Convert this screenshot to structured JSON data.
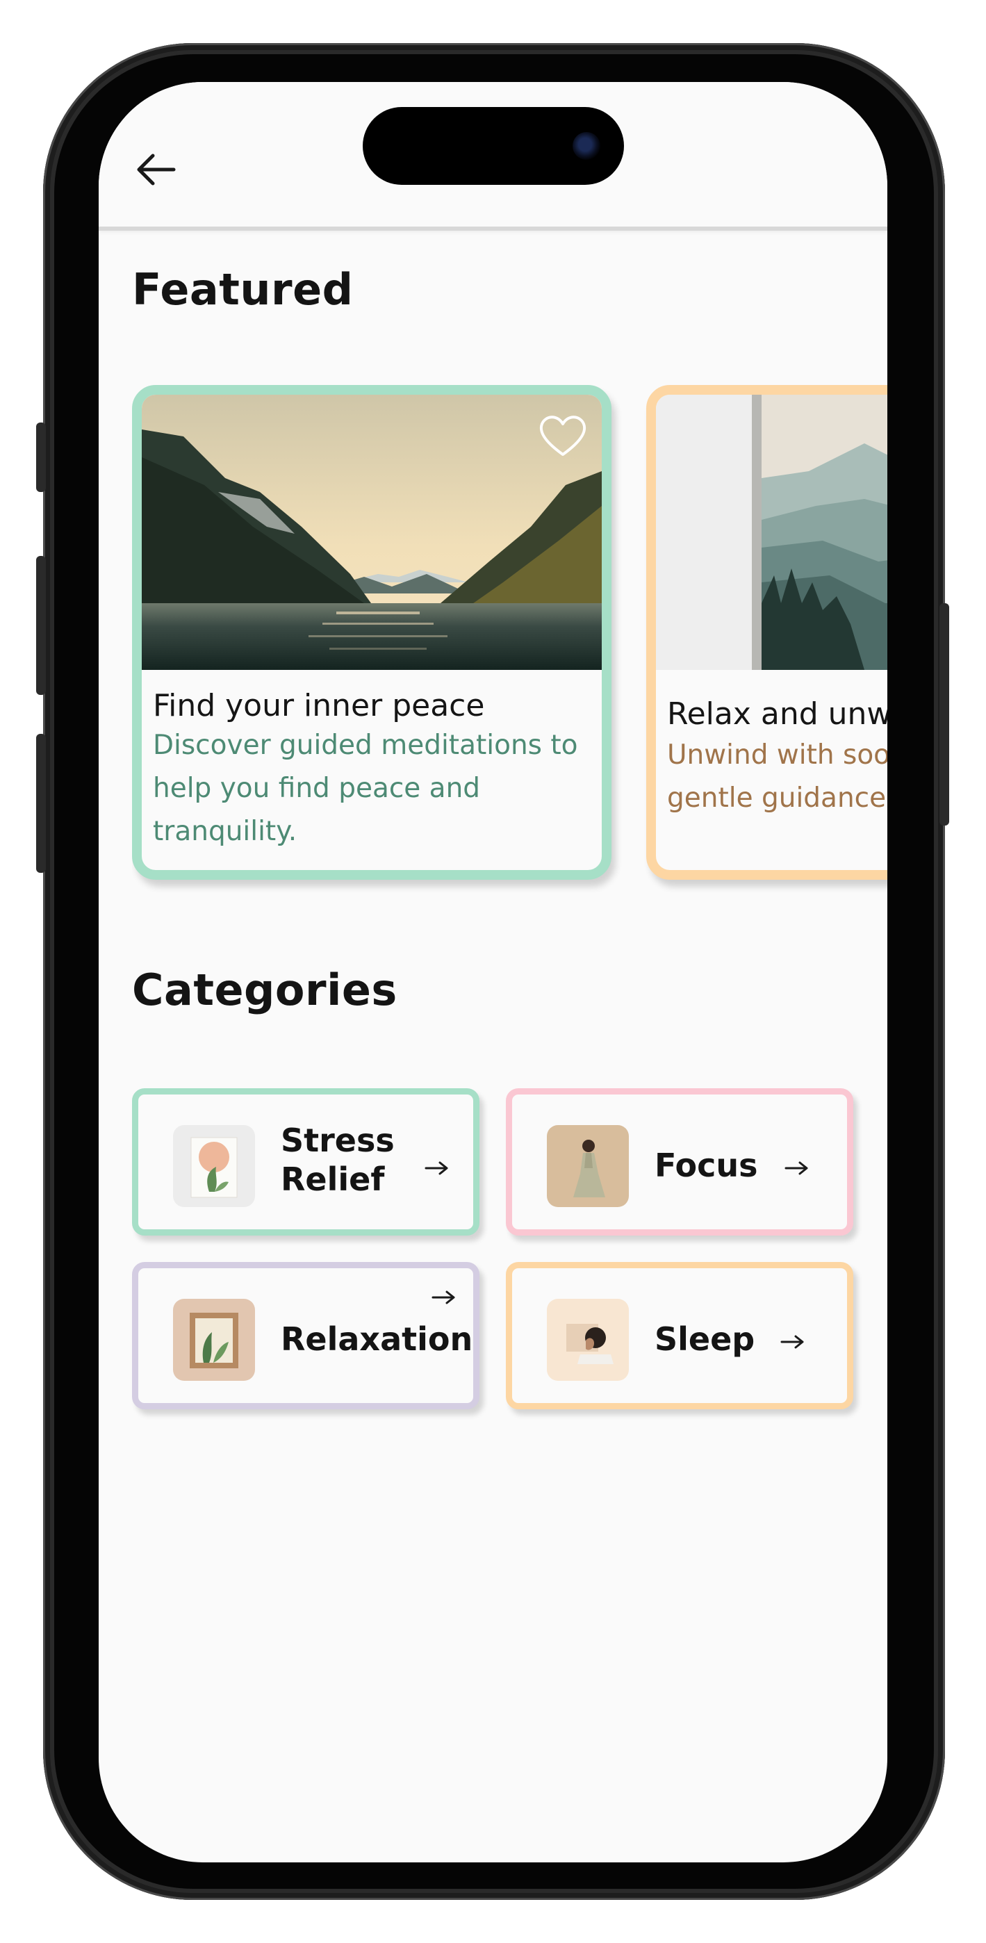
{
  "header": {
    "back_icon": "arrow-left-icon"
  },
  "featured": {
    "title": "Featured",
    "cards": [
      {
        "title": "Find your inner peace",
        "description": "Discover guided meditations to help you find peace and tranquility.",
        "border_color": "#a6dfc7",
        "favorite_icon": "heart-outline-icon"
      },
      {
        "title": "Relax and unwind",
        "description": "Unwind with soothing sounds and gentle guidance.",
        "border_color": "#fdd6a3"
      }
    ]
  },
  "categories": {
    "title": "Categories",
    "items": [
      {
        "label_line1": "Stress",
        "label_line2": "Relief",
        "border_color": "#a6dfc7",
        "arrow_icon": "arrow-right-icon"
      },
      {
        "label": "Focus",
        "border_color": "#fac7d2",
        "arrow_icon": "arrow-right-icon"
      },
      {
        "label": "Relaxation",
        "border_color": "#d4cde2",
        "arrow_icon": "arrow-right-icon"
      },
      {
        "label": "Sleep",
        "border_color": "#fdd6a3",
        "arrow_icon": "arrow-right-icon"
      }
    ]
  },
  "colors": {
    "mint": "#a6dfc7",
    "pink": "#fac7d2",
    "lavender": "#d4cde2",
    "peach": "#fdd6a3",
    "desc_green": "#4d8a74",
    "desc_brown": "#a0744a"
  }
}
